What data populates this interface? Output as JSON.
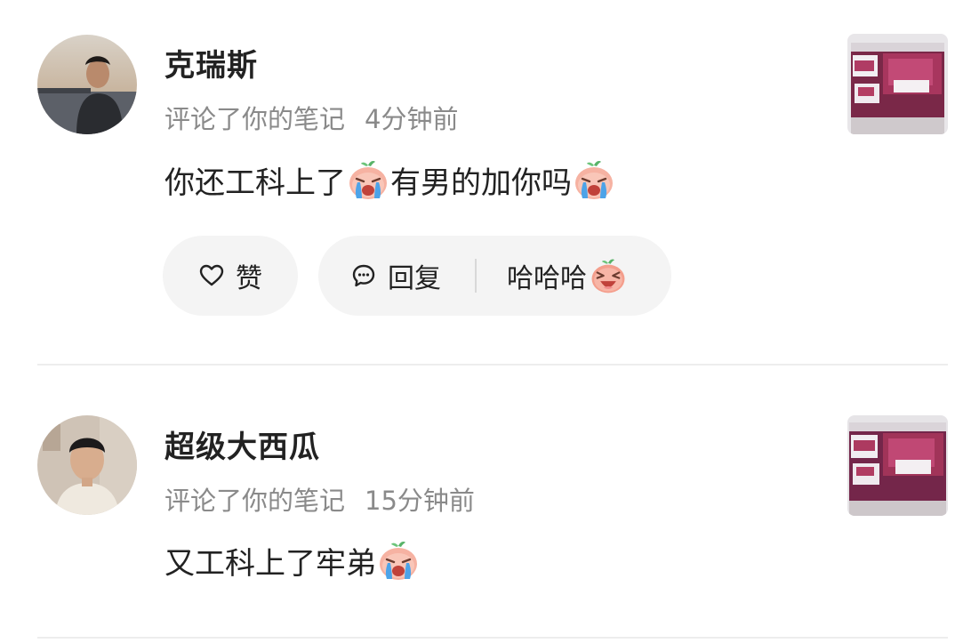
{
  "comments": [
    {
      "username": "克瑞斯",
      "action": "评论了你的笔记",
      "time": "4分钟前",
      "text_part1": "你还工科上了",
      "text_part2": "有男的加你吗",
      "emoji": "crying-face-emoji"
    },
    {
      "username": "超级大西瓜",
      "action": "评论了你的笔记",
      "time": "15分钟前",
      "text_part1": "又工科上了牢弟",
      "emoji": "crying-face-emoji"
    }
  ],
  "actions": {
    "like_label": "赞",
    "reply_label": "回复",
    "quick_reply": "哈哈哈",
    "quick_reply_emoji": "laughing-face-emoji",
    "like_icon": "heart-outline-icon",
    "reply_icon": "speech-bubble-icon"
  },
  "colors": {
    "text": "#222222",
    "meta": "#8a8a8a",
    "pill_bg": "#f4f4f4",
    "divider": "#ededed"
  }
}
